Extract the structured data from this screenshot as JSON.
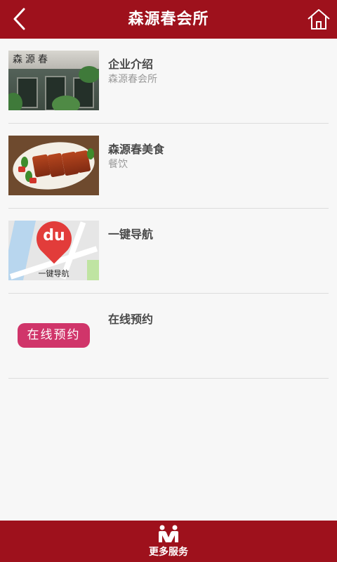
{
  "header": {
    "title": "森源春会所",
    "back_icon": "back-arrow-icon",
    "home_icon": "home-icon"
  },
  "items": [
    {
      "title": "企业介绍",
      "subtitle": "森源春会所",
      "thumb_sign": "森源春"
    },
    {
      "title": "森源春美食",
      "subtitle": "餐饮"
    },
    {
      "title": "一键导航",
      "subtitle": "",
      "thumb_pin_text": "du",
      "thumb_caption": "一键导航"
    },
    {
      "title": "在线预约",
      "subtitle": "",
      "thumb_button": "在线预约"
    }
  ],
  "footer": {
    "label": "更多服务",
    "icon": "people-icon"
  },
  "colors": {
    "primary": "#9e111c",
    "reserve_button": "#d0356a",
    "background": "#f7f7f7"
  }
}
